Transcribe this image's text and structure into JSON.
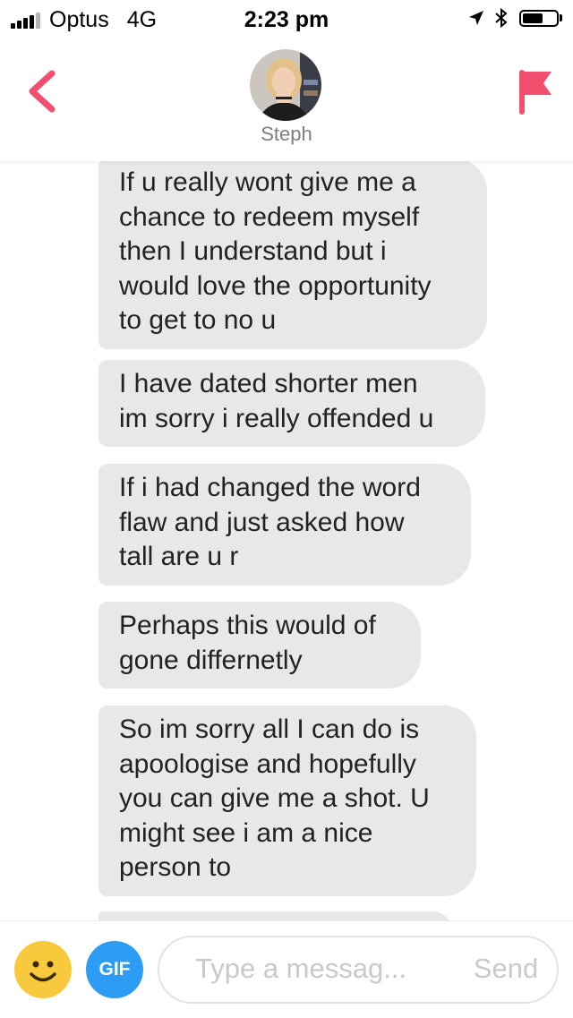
{
  "status_bar": {
    "carrier": "Optus",
    "network": "4G",
    "time": "2:23 pm",
    "signal_bars": 4,
    "signal_total": 5,
    "battery_level": 0.6
  },
  "header": {
    "contact_name": "Steph",
    "accent_color": "#f0506e"
  },
  "messages": [
    {
      "sender": "them",
      "lines": [
        "If u really wont give me a",
        "chance to redeem myself",
        "then I understand but i",
        "would love the opportunity",
        "to get to no u"
      ]
    },
    {
      "sender": "them",
      "lines": [
        "I have dated shorter men",
        "im sorry i really offended u"
      ]
    },
    {
      "sender": "them",
      "lines": [
        "If i had changed the word",
        "flaw and just asked how",
        "tall are u r"
      ]
    },
    {
      "sender": "them",
      "lines": [
        "Perhaps this would of",
        "gone differnetly"
      ]
    },
    {
      "sender": "them",
      "lines": [
        "So im sorry all I can do is",
        "apoologise and hopefully",
        "you can give me a shot. U",
        "might see i am a nice",
        "person  to"
      ]
    }
  ],
  "input": {
    "placeholder": "Type a messag...",
    "send_label": "Send",
    "gif_label": "GIF",
    "emoji_icon": "smiley-icon"
  }
}
